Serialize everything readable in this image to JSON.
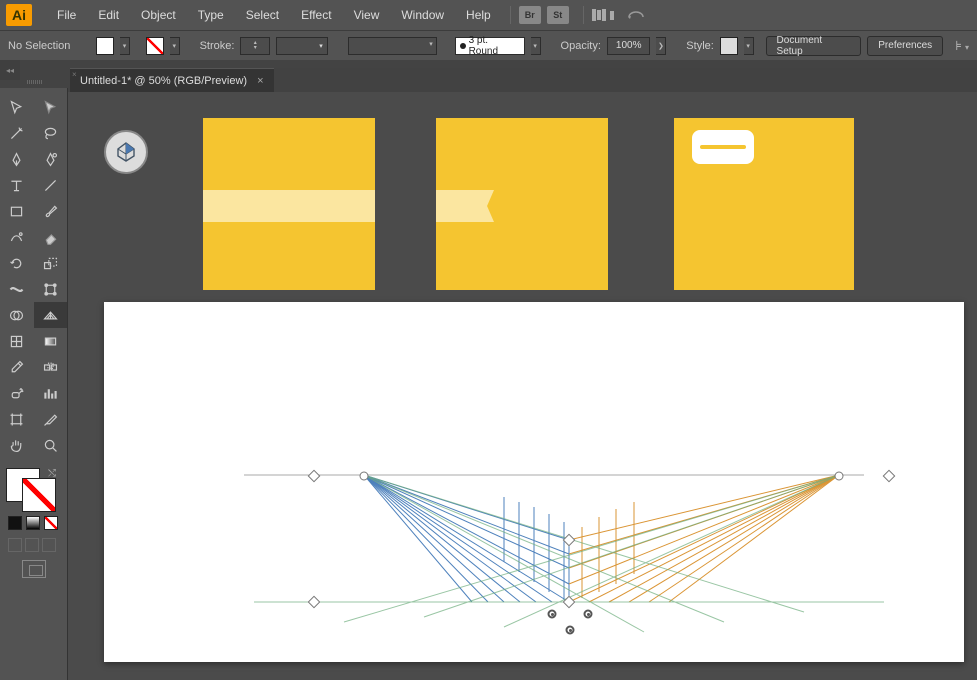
{
  "menu": {
    "items": [
      "File",
      "Edit",
      "Object",
      "Type",
      "Select",
      "Effect",
      "View",
      "Window",
      "Help"
    ],
    "badges": [
      "Br",
      "St"
    ]
  },
  "controlbar": {
    "selection_label": "No Selection",
    "stroke_label": "Stroke:",
    "profile_label": "3 pt. Round",
    "opacity_label": "Opacity:",
    "opacity_value": "100%",
    "style_label": "Style:",
    "doc_setup": "Document Setup",
    "preferences": "Preferences"
  },
  "tab": {
    "title": "Untitled-1* @ 50% (RGB/Preview)"
  },
  "tools": [
    [
      "selection",
      "direct-selection"
    ],
    [
      "magic-wand",
      "lasso"
    ],
    [
      "pen",
      "curvature"
    ],
    [
      "type",
      "line"
    ],
    [
      "rectangle",
      "paintbrush"
    ],
    [
      "shaper",
      "eraser"
    ],
    [
      "rotate",
      "scale"
    ],
    [
      "width",
      "free-transform"
    ],
    [
      "shape-builder",
      "perspective-grid"
    ],
    [
      "mesh",
      "gradient"
    ],
    [
      "eyedropper",
      "blend"
    ],
    [
      "symbol-sprayer",
      "column-graph"
    ],
    [
      "artboard",
      "slice"
    ],
    [
      "hand",
      "zoom"
    ]
  ],
  "selected_tool": "perspective-grid",
  "colors": {
    "fill": "#ffffff",
    "stroke": "none"
  }
}
